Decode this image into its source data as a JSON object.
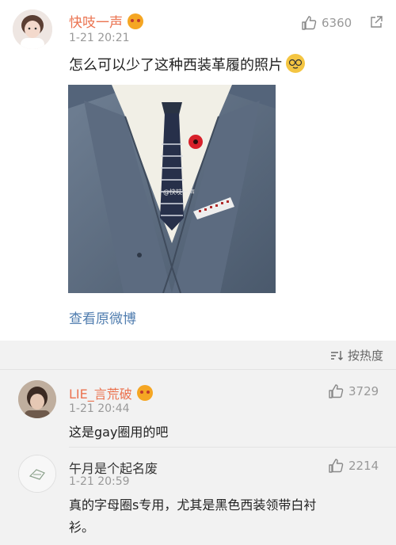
{
  "post": {
    "username": "快吱一声",
    "time": "1-21 20:21",
    "like_count": "6360",
    "text": "怎么可以少了这种西装革履的照片",
    "watermark": "@快吱一声",
    "view_original": "查看原微博"
  },
  "sort": {
    "label": "按热度"
  },
  "comments": [
    {
      "username": "LIE_言荒破",
      "time": "1-21 20:44",
      "like_count": "3729",
      "text": "这是gay圈用的吧"
    },
    {
      "username": "午月是个起名废",
      "time": "1-21 20:59",
      "like_count": "2214",
      "text_line1": "真的字母圈s专用，尤其是黑色西装领带白衬",
      "text_line2": "衫。"
    }
  ],
  "colors": {
    "username": "#eb7350",
    "link": "#507daf",
    "meta": "#999999",
    "comments_bg": "#f2f2f2"
  }
}
